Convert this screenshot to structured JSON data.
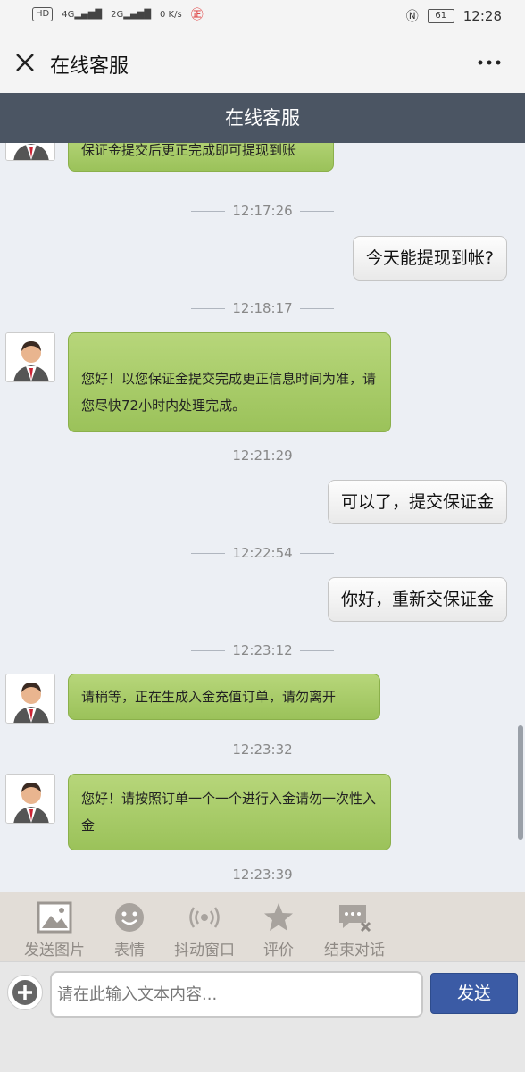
{
  "status_bar": {
    "hd": "HD",
    "net1": "4G",
    "net2": "2G",
    "speed": "0 K/s",
    "battery": "61",
    "time": "12:28"
  },
  "top_bar": {
    "title": "在线客服"
  },
  "app_header": {
    "title": "在线客服"
  },
  "messages": [
    {
      "type": "in",
      "text": "保证金提交后更正完成即可提现到账"
    },
    {
      "type": "time",
      "text": "12:17:26"
    },
    {
      "type": "out",
      "text": "今天能提现到帐?"
    },
    {
      "type": "time",
      "text": "12:18:17"
    },
    {
      "type": "in",
      "text": "您好！以您保证金提交完成更正信息时间为准，请您尽快72小时内处理完成。"
    },
    {
      "type": "time",
      "text": "12:21:29"
    },
    {
      "type": "out",
      "text": "可以了，提交保证金"
    },
    {
      "type": "time",
      "text": "12:22:54"
    },
    {
      "type": "out",
      "text": "你好，重新交保证金"
    },
    {
      "type": "time",
      "text": "12:23:12"
    },
    {
      "type": "in",
      "text": "请稍等，正在生成入金充值订单，请勿离开"
    },
    {
      "type": "time",
      "text": "12:23:32"
    },
    {
      "type": "in",
      "text": "您好！请按照订单一个一个进行入金请勿一次性入金"
    },
    {
      "type": "time",
      "text": "12:23:39"
    }
  ],
  "toolbar": {
    "send_image": "发送图片",
    "emoji": "表情",
    "shake": "抖动窗口",
    "rate": "评价",
    "end_chat": "结束对话"
  },
  "input": {
    "placeholder": "请在此输入文本内容...",
    "send_label": "发送"
  },
  "colors": {
    "header_bg": "#4b5563",
    "agent_bubble": "#a8cc68",
    "send_button": "#3b5ba5"
  }
}
